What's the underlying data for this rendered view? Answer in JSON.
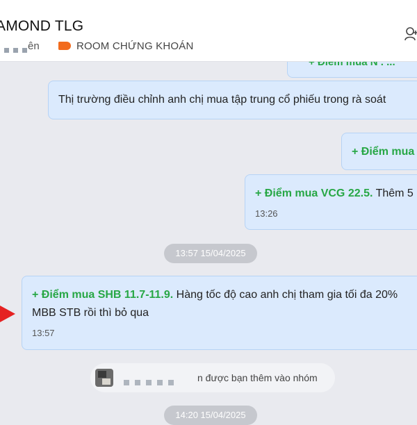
{
  "header": {
    "group_name": "AMOND TLG",
    "members_suffix": "ên",
    "tag_label": "ROOM CHỨNG KHOÁN",
    "tag_color": "#f26b1d"
  },
  "messages": [
    {
      "id": "m1",
      "partial_text": "+ Điểm mua N . ..."
    },
    {
      "id": "m2",
      "text": "Thị trường điều chỉnh anh chị mua tập trung cổ phiếu trong rà soát"
    },
    {
      "id": "m3",
      "prefix": "+ ",
      "highlight": "Điểm mua"
    },
    {
      "id": "m4",
      "highlight": "+ Điểm mua VCG 22.5.",
      "rest": " Thêm 5",
      "time": "13:26"
    },
    {
      "id": "m5",
      "highlight": "+ Điểm mua SHB 11.7-11.9.",
      "rest": " Hàng tốc độ cao anh chị tham gia tối đa 20%",
      "line2": "MBB STB rồi thì bỏ qua",
      "time": "13:57"
    }
  ],
  "date_separators": [
    "13:57 15/04/2025",
    "14:20 15/04/2025"
  ],
  "system_message": {
    "text": "n được bạn thêm vào nhóm"
  },
  "colors": {
    "bubble": "#dbeafd",
    "highlight_green": "#27a745",
    "arrow_red": "#e52222"
  },
  "icons": {
    "add_member": "add-member-icon",
    "tag": "tag-icon",
    "annotation": "red-arrow-pointer"
  }
}
